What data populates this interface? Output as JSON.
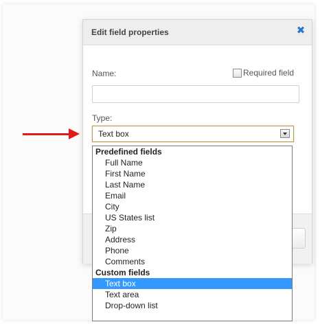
{
  "dialog": {
    "title": "Edit field properties",
    "close_icon": "close-icon",
    "name_label": "Name:",
    "name_value": "",
    "required_label": "Required field",
    "required_checked": false,
    "type_label": "Type:",
    "type_value": "Text box"
  },
  "dropdown": {
    "groups": [
      {
        "label": "Predefined fields",
        "items": [
          "Full Name",
          "First Name",
          "Last Name",
          "Email",
          "City",
          "US States list",
          "Zip",
          "Address",
          "Phone",
          "Comments"
        ]
      },
      {
        "label": "Custom fields",
        "items": [
          "Text box",
          "Text area",
          "Drop-down list"
        ]
      }
    ],
    "selected": "Text box"
  },
  "colors": {
    "accent": "#2a77c9",
    "selection": "#3399ff",
    "arrow": "#e11b1b"
  }
}
